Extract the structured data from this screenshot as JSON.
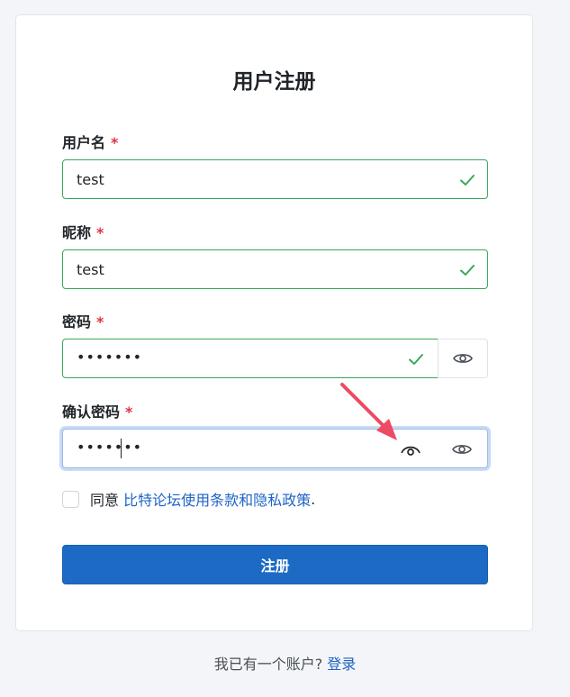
{
  "form": {
    "title": "用户注册",
    "required_mark": "*",
    "username": {
      "label": "用户名",
      "value": "test"
    },
    "nickname": {
      "label": "昵称",
      "value": "test"
    },
    "password": {
      "label": "密码",
      "value": "•••••••"
    },
    "confirm_password": {
      "label": "确认密码",
      "value": "•••••••"
    },
    "agree": {
      "prefix": "同意",
      "link": "比特论坛使用条款和隐私政策",
      "suffix": "."
    },
    "submit_label": "注册"
  },
  "footer": {
    "text": "我已有一个账户?",
    "login_link": "登录"
  },
  "colors": {
    "valid_border": "#3aa856",
    "primary": "#1d6ac5",
    "link": "#1e63c5",
    "required": "#dc3545",
    "annotation_arrow": "#ec4b63"
  },
  "icons": [
    "check-icon",
    "eye-icon",
    "eye-closed-icon",
    "annotation-arrow"
  ]
}
